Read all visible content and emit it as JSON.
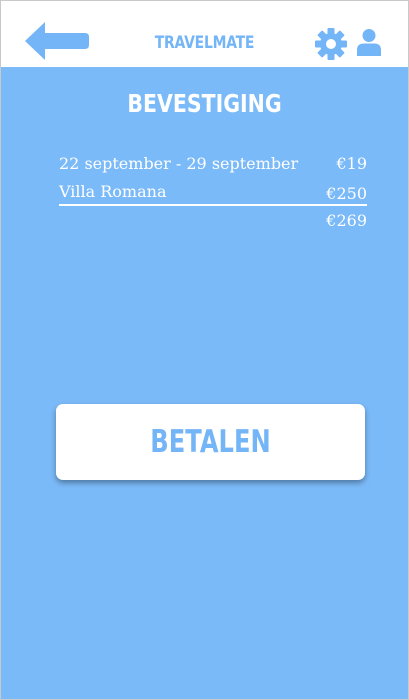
{
  "header": {
    "app_title": "TRAVELMATE",
    "back_icon": "arrow-left-icon",
    "settings_icon": "gear-icon",
    "profile_icon": "user-icon",
    "accent_color": "#74b5f7"
  },
  "main": {
    "background_color": "#7bbaf8",
    "page_title": "BEVESTIGING",
    "summary": {
      "items": [
        {
          "label": "22 september - 29 september",
          "price": "€19"
        },
        {
          "label": "Villa Romana",
          "price": "€250"
        }
      ],
      "total": "€269"
    },
    "pay_button_label": "BETALEN"
  }
}
